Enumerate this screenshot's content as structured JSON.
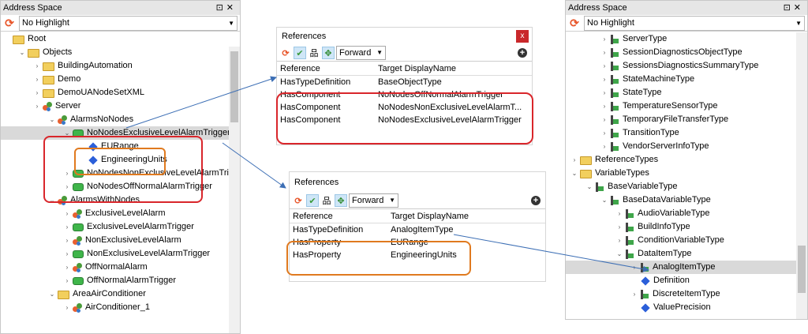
{
  "left_panel": {
    "title": "Address Space",
    "highlight_value": "No Highlight",
    "tree": [
      {
        "label": "Root",
        "icon": "folder-icon",
        "level": 0,
        "chevron": ""
      },
      {
        "label": "Objects",
        "icon": "folder-icon",
        "level": 1,
        "chevron": "v"
      },
      {
        "label": "BuildingAutomation",
        "icon": "folder-icon",
        "level": 2,
        "chevron": ">"
      },
      {
        "label": "Demo",
        "icon": "folder-icon",
        "level": 2,
        "chevron": ">"
      },
      {
        "label": "DemoUANodeSetXML",
        "icon": "folder-icon",
        "level": 2,
        "chevron": ">"
      },
      {
        "label": "Server",
        "icon": "object-icon",
        "level": 2,
        "chevron": ">"
      },
      {
        "label": "AlarmsNoNodes",
        "icon": "object-icon",
        "level": 3,
        "chevron": "v"
      },
      {
        "label": "NoNodesExclusiveLevelAlarmTrigger",
        "icon": "variable-icon",
        "level": 4,
        "chevron": "v",
        "selected": true
      },
      {
        "label": "EURange",
        "icon": "property-icon",
        "level": 5,
        "chevron": ""
      },
      {
        "label": "EngineeringUnits",
        "icon": "property-icon",
        "level": 5,
        "chevron": ""
      },
      {
        "label": "NoNodesNonExclusiveLevelAlarmTrig",
        "icon": "variable-icon",
        "level": 4,
        "chevron": ">"
      },
      {
        "label": "NoNodesOffNormalAlarmTrigger",
        "icon": "variable-icon",
        "level": 4,
        "chevron": ">"
      },
      {
        "label": "AlarmsWithNodes",
        "icon": "object-icon",
        "level": 3,
        "chevron": "v"
      },
      {
        "label": "ExclusiveLevelAlarm",
        "icon": "object-icon",
        "level": 4,
        "chevron": ">"
      },
      {
        "label": "ExclusiveLevelAlarmTrigger",
        "icon": "variable-icon",
        "level": 4,
        "chevron": ">"
      },
      {
        "label": "NonExclusiveLevelAlarm",
        "icon": "object-icon",
        "level": 4,
        "chevron": ">"
      },
      {
        "label": "NonExclusiveLevelAlarmTrigger",
        "icon": "variable-icon",
        "level": 4,
        "chevron": ">"
      },
      {
        "label": "OffNormalAlarm",
        "icon": "object-icon",
        "level": 4,
        "chevron": ">"
      },
      {
        "label": "OffNormalAlarmTrigger",
        "icon": "variable-icon",
        "level": 4,
        "chevron": ">"
      },
      {
        "label": "AreaAirConditioner",
        "icon": "folder-icon",
        "level": 3,
        "chevron": "v"
      },
      {
        "label": "AirConditioner_1",
        "icon": "object-icon",
        "level": 4,
        "chevron": ">"
      }
    ]
  },
  "references_top": {
    "title": "References",
    "close_label": "x",
    "direction": "Forward",
    "columns": [
      "Reference",
      "Target DisplayName"
    ],
    "rows": [
      [
        "HasTypeDefinition",
        "BaseObjectType"
      ],
      [
        "HasComponent",
        "NoNodesOffNormalAlarmTrigger"
      ],
      [
        "HasComponent",
        "NoNodesNonExclusiveLevelAlarmT..."
      ],
      [
        "HasComponent",
        "NoNodesExclusiveLevelAlarmTrigger"
      ]
    ]
  },
  "references_bottom": {
    "title": "References",
    "direction": "Forward",
    "columns": [
      "Reference",
      "Target DisplayName"
    ],
    "rows": [
      [
        "HasTypeDefinition",
        "AnalogItemType"
      ],
      [
        "HasProperty",
        "EURange"
      ],
      [
        "HasProperty",
        "EngineeringUnits"
      ]
    ]
  },
  "right_panel": {
    "title": "Address Space",
    "highlight_value": "No Highlight",
    "tree": [
      {
        "label": "ServerType",
        "icon": "object-type-icon",
        "level": 3,
        "chevron": ">"
      },
      {
        "label": "SessionDiagnosticsObjectType",
        "icon": "object-type-icon",
        "level": 3,
        "chevron": ">"
      },
      {
        "label": "SessionsDiagnosticsSummaryType",
        "icon": "object-type-icon",
        "level": 3,
        "chevron": ">"
      },
      {
        "label": "StateMachineType",
        "icon": "object-type-icon",
        "level": 3,
        "chevron": ">"
      },
      {
        "label": "StateType",
        "icon": "object-type-icon",
        "level": 3,
        "chevron": ">"
      },
      {
        "label": "TemperatureSensorType",
        "icon": "object-type-icon",
        "level": 3,
        "chevron": ">"
      },
      {
        "label": "TemporaryFileTransferType",
        "icon": "object-type-icon",
        "level": 3,
        "chevron": ">"
      },
      {
        "label": "TransitionType",
        "icon": "object-type-icon",
        "level": 3,
        "chevron": ">"
      },
      {
        "label": "VendorServerInfoType",
        "icon": "object-type-icon",
        "level": 3,
        "chevron": ">"
      },
      {
        "label": "ReferenceTypes",
        "icon": "folder-icon",
        "level": 1,
        "chevron": ">"
      },
      {
        "label": "VariableTypes",
        "icon": "folder-icon",
        "level": 1,
        "chevron": "v"
      },
      {
        "label": "BaseVariableType",
        "icon": "variable-type-icon",
        "level": 2,
        "chevron": "v"
      },
      {
        "label": "BaseDataVariableType",
        "icon": "variable-type-icon",
        "level": 3,
        "chevron": "v"
      },
      {
        "label": "AudioVariableType",
        "icon": "variable-type-icon",
        "level": 4,
        "chevron": ">"
      },
      {
        "label": "BuildInfoType",
        "icon": "variable-type-icon",
        "level": 4,
        "chevron": ">"
      },
      {
        "label": "ConditionVariableType",
        "icon": "variable-type-icon",
        "level": 4,
        "chevron": ">"
      },
      {
        "label": "DataItemType",
        "icon": "variable-type-icon",
        "level": 4,
        "chevron": "v"
      },
      {
        "label": "AnalogItemType",
        "icon": "variable-type-icon",
        "level": 5,
        "chevron": ">",
        "selected": true
      },
      {
        "label": "Definition",
        "icon": "property-icon",
        "level": 5,
        "chevron": ""
      },
      {
        "label": "DiscreteItemType",
        "icon": "variable-type-icon",
        "level": 5,
        "chevron": ">"
      },
      {
        "label": "ValuePrecision",
        "icon": "property-icon",
        "level": 5,
        "chevron": ""
      }
    ]
  },
  "colors": {
    "red_annotation": "#d9262b",
    "orange_annotation": "#e07a1f",
    "arrow": "#3d6fb5"
  }
}
